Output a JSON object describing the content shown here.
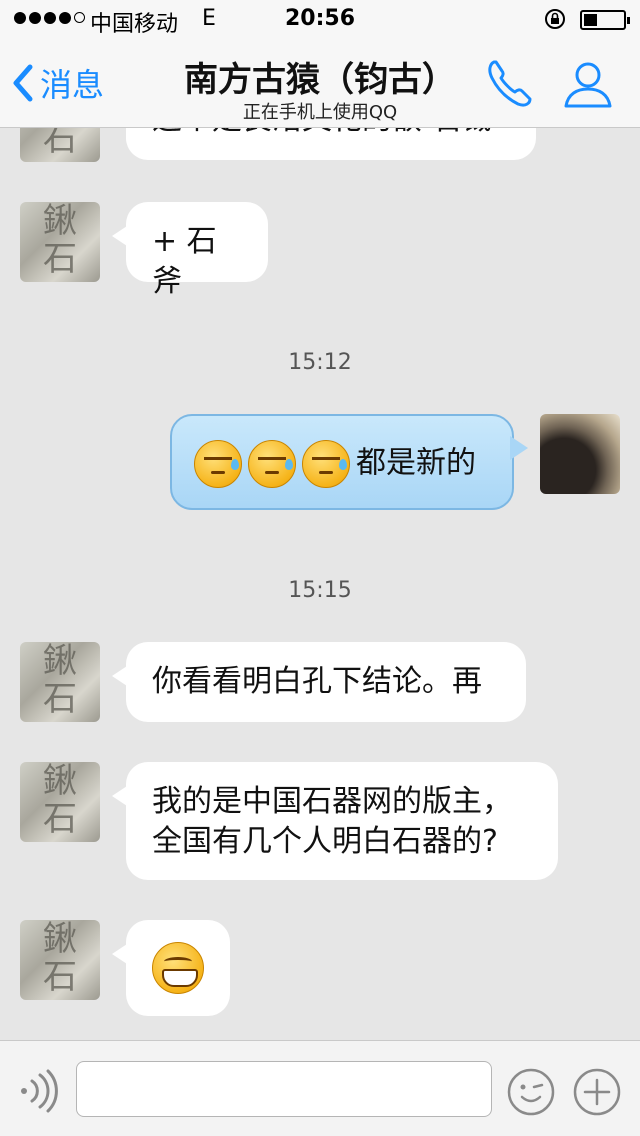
{
  "status_bar": {
    "carrier": "中国移动",
    "network": "E",
    "time": "20:56",
    "battery_level": 0.35
  },
  "nav": {
    "back_label": "消息",
    "title": "南方古猿（钧古）",
    "subtitle": "正在手机上使用QQ",
    "accent_color": "#1a8cff"
  },
  "messages": [
    {
      "sender": "contact",
      "text": "这个是良渚文化的嵌 石钺"
    },
    {
      "sender": "contact",
      "text": "+ 石斧"
    },
    {
      "type": "timestamp",
      "text": "15:12"
    },
    {
      "sender": "me",
      "emoji": [
        "sweat-squint-emoji",
        "sweat-squint-emoji",
        "sweat-squint-emoji"
      ],
      "text": "都是新的"
    },
    {
      "type": "timestamp",
      "text": "15:15"
    },
    {
      "sender": "contact",
      "text": "你看看明白孔下结论。再"
    },
    {
      "sender": "contact",
      "lines": [
        "我的是中国石器网的版主，",
        "全国有几个人明白石器的?"
      ]
    },
    {
      "sender": "contact",
      "emoji": [
        "grin-emoji"
      ]
    }
  ],
  "input_bar": {
    "value": "",
    "icons": [
      "voice-icon",
      "emoji-face-icon",
      "plus-icon"
    ]
  }
}
